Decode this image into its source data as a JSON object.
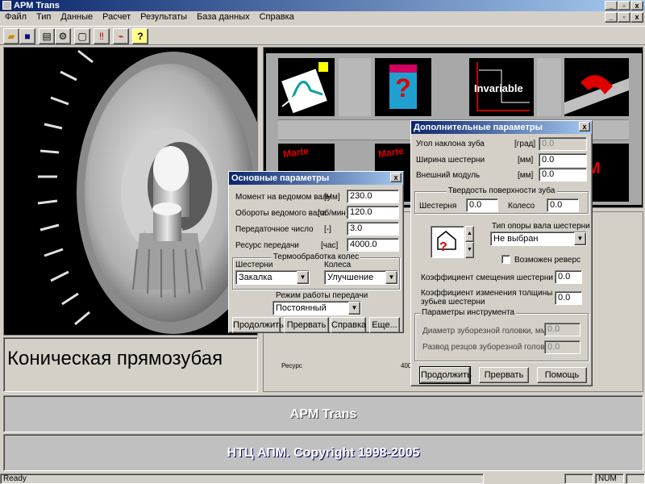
{
  "window": {
    "title": "APM Trans",
    "btn_min": "_",
    "btn_max": "▫",
    "btn_close": "x"
  },
  "mdi": {
    "btn_min": "_",
    "btn_max": "▫",
    "btn_close": "x"
  },
  "menu": [
    "Файл",
    "Тип",
    "Данные",
    "Расчет",
    "Результаты",
    "База данных",
    "Справка"
  ],
  "toolbar": [
    "open-icon",
    "save-icon",
    "print-icon",
    "gear-icon",
    "window-icon",
    "alert-icon",
    "chart-icon",
    "help-icon"
  ],
  "gear_caption": "Коническая прямозубая",
  "thumbs": {
    "invariable": "Invariable",
    "marte": "Marte"
  },
  "results_label": "Ресурс",
  "results_value": "400",
  "basic": {
    "title": "Основные параметры",
    "close": "x",
    "rows": [
      {
        "label": "Момент на ведомом валу",
        "unit": "[Нм]",
        "value": "230.0"
      },
      {
        "label": "Обороты ведомого вала",
        "unit": "[об/мин]",
        "value": "120.0"
      },
      {
        "label": "Передаточное число",
        "unit": "[-]",
        "value": "3.0"
      },
      {
        "label": "Ресурс передачи",
        "unit": "[час]",
        "value": "4000.0"
      }
    ],
    "heat_group": "Термообработка колес",
    "pinion_label": "Шестерни",
    "wheel_label": "Колеса",
    "pinion_value": "Закалка",
    "wheel_value": "Улучшение",
    "mode_label": "Режим работы передачи",
    "mode_value": "Постоянный",
    "buttons": {
      "continue": "Продолжить",
      "abort": "Прервать",
      "help": "Справка",
      "more": "Еще..."
    }
  },
  "extra": {
    "title": "Дополнительные параметры",
    "close": "x",
    "rows": [
      {
        "label": "Угол наклона зуба",
        "unit": "[град]",
        "value": "0.0",
        "disabled": true
      },
      {
        "label": "Ширина  шестерни",
        "unit": "[мм]",
        "value": "0.0"
      },
      {
        "label": "Внешний модуль",
        "unit": "[мм]",
        "value": "0.0"
      }
    ],
    "hardness_group": "Твердость поверхности зуба",
    "hardness_pinion_label": "Шестерня",
    "hardness_pinion_value": "0.0",
    "hardness_wheel_label": "Колесо",
    "hardness_wheel_value": "0.0",
    "support_label": "Тип  опоры вала шестерни",
    "support_value": "Не выбран",
    "reverse_label": "Возможен реверс",
    "shift_label": "Коэффициент смещения шестерни",
    "shift_value": "0.0",
    "thickness_label_1": "Коэффициент изменения толщины",
    "thickness_label_2": "зубьев шестерни",
    "thickness_value": "0.0",
    "tool_group": "Параметры инструмента",
    "tool_diameter_label": "Диаметр зуборезной головки, мм",
    "tool_diameter_value": "0.0",
    "tool_spread_label": "Развод резцов зуборезной головки",
    "tool_spread_value": "0.0",
    "buttons": {
      "continue": "Продолжить",
      "abort": "Прервать",
      "help": "Помощь"
    }
  },
  "banner_top": "APM Trans",
  "banner_bottom": "НТЦ АПМ. Copyright 1998-2005",
  "status": {
    "left": "Ready",
    "num": "NUM"
  },
  "colors": {
    "banner_text": "#2020a0",
    "title_start": "#0a246a",
    "title_end": "#a6caf0"
  }
}
